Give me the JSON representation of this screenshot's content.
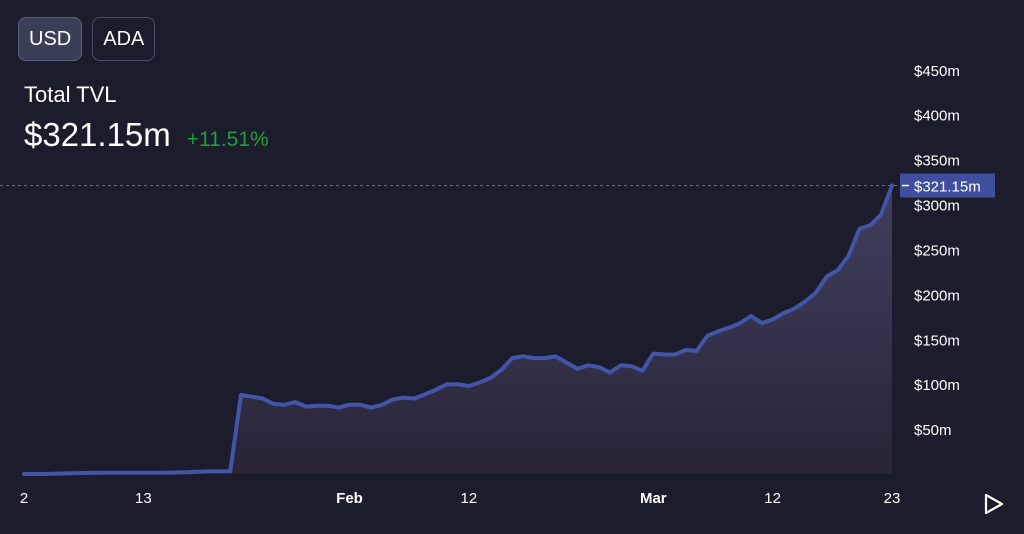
{
  "currency_toggle": {
    "options": [
      {
        "label": "USD",
        "selected": true
      },
      {
        "label": "ADA",
        "selected": false
      }
    ]
  },
  "header": {
    "title": "Total TVL",
    "value": "$321.15m",
    "change": "+11.51%",
    "change_color": "#1f9d3a"
  },
  "colors": {
    "background": "#1b1c2c",
    "line": "#4355a6",
    "price_tag_bg": "#3f4f9e",
    "axis_text": "#ffffff"
  },
  "chart_data": {
    "type": "area",
    "x_ticks": [
      {
        "label": "2",
        "index": 0,
        "bold": false
      },
      {
        "label": "13",
        "index": 11,
        "bold": false
      },
      {
        "label": "Feb",
        "index": 30,
        "bold": true
      },
      {
        "label": "12",
        "index": 41,
        "bold": false
      },
      {
        "label": "Mar",
        "index": 58,
        "bold": true
      },
      {
        "label": "12",
        "index": 69,
        "bold": false
      },
      {
        "label": "23",
        "index": 80,
        "bold": false
      }
    ],
    "y_ticks": [
      "$50m",
      "$100m",
      "$150m",
      "$200m",
      "$250m",
      "$300m",
      "$350m",
      "$400m",
      "$450m"
    ],
    "y_tick_values": [
      50,
      100,
      150,
      200,
      250,
      300,
      350,
      400,
      450
    ],
    "ylim": [
      0,
      472
    ],
    "current_value": 321.15,
    "current_label": "$321.15m",
    "series": [
      {
        "values": [
          0,
          0,
          0,
          0.4,
          0.7,
          1,
          1.2,
          1.3,
          1.3,
          1.3,
          1.3,
          1.3,
          1.3,
          1.5,
          1.7,
          2,
          2.5,
          3,
          3,
          3,
          88,
          86,
          84,
          78,
          77,
          80,
          75,
          76,
          76,
          74,
          77,
          77,
          74,
          77,
          83,
          85,
          84,
          89,
          94,
          100,
          100,
          98,
          102,
          107,
          116,
          129,
          131,
          129,
          129,
          131,
          124,
          117,
          121,
          119,
          113,
          121,
          120,
          115,
          134,
          133,
          133,
          138,
          137,
          154,
          159,
          163,
          168,
          176,
          168,
          172,
          179,
          184,
          192,
          202,
          220,
          227,
          243,
          273,
          277,
          289,
          321.15
        ]
      }
    ]
  }
}
